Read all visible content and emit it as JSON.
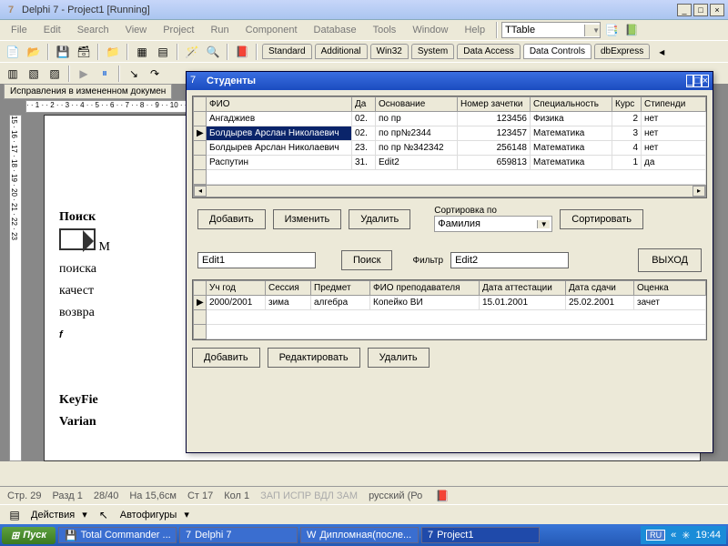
{
  "main_title": "Delphi 7 - Project1 [Running]",
  "menu": [
    "File",
    "Edit",
    "Search",
    "View",
    "Project",
    "Run",
    "Component",
    "Database",
    "Tools",
    "Window",
    "Help"
  ],
  "combo_class": "TTable",
  "palette_tabs": [
    "Standard",
    "Additional",
    "Win32",
    "System",
    "Data Access",
    "Data Controls",
    "dbExpress"
  ],
  "palette_active": 5,
  "doc_tab": "Исправления в измененном докумен",
  "page": {
    "heading": "Поиск",
    "lines": [
      "поиска",
      "качест",
      "возвра"
    ],
    "italic_f": "f",
    "key": "KeyFie",
    "varian": "Varian"
  },
  "child": {
    "title": "Студенты",
    "cols": [
      "ФИО",
      "Да",
      "Основание",
      "Номер зачетки",
      "Специальность",
      "Курс",
      "Стипенди"
    ],
    "rows": [
      {
        "fio": "Ангаджиев",
        "d": "02.",
        "osn": "по пр",
        "num": "123456",
        "spec": "Физика",
        "kurs": "2",
        "stip": "нет"
      },
      {
        "fio": "Болдырев Арслан Николаевич",
        "d": "02.",
        "osn": "по пр№2344",
        "num": "123457",
        "spec": "Математика",
        "kurs": "3",
        "stip": "нет"
      },
      {
        "fio": "Болдырев Арслан Николаевич",
        "d": "23.",
        "osn": "по пр №342342",
        "num": "256148",
        "spec": "Математика",
        "kurs": "4",
        "stip": "нет"
      },
      {
        "fio": "Распутин",
        "d": "31.",
        "osn": "Edit2",
        "num": "659813",
        "spec": "Математика",
        "kurs": "1",
        "stip": "да"
      }
    ],
    "sel_row": 1,
    "btns1": {
      "add": "Добавить",
      "edit": "Изменить",
      "del": "Удалить"
    },
    "sort_label": "Сортировка по",
    "sort_value": "Фамилия",
    "sort_btn": "Сортировать",
    "exit_btn": "ВЫХОД",
    "edit1": "Edit1",
    "search_btn": "Поиск",
    "filter_lbl": "Фильтр",
    "edit2": "Edit2",
    "cols2": [
      "Уч год",
      "Сессия",
      "Предмет",
      "ФИО преподавателя",
      "Дата аттестации",
      "Дата сдачи",
      "Оценка"
    ],
    "row2": {
      "year": "2000/2001",
      "sess": "зима",
      "subj": "алгебра",
      "teach": "Копейко ВИ",
      "att": "15.01.2001",
      "sd": "25.02.2001",
      "gr": "зачет"
    },
    "btns2": {
      "add": "Добавить",
      "edit": "Редактировать",
      "del": "Удалить"
    }
  },
  "bottombar": {
    "actions": "Действия",
    "autoshapes": "Автофигуры"
  },
  "status": {
    "s1": "Стр. 29",
    "s2": "Разд 1",
    "s3": "28/40",
    "s4": "На 15,6см",
    "s5": "Ст 17",
    "s6": "Кол 1",
    "dim": "ЗАП  ИСПР  ВДЛ  ЗАМ",
    "lang": "русский (Ро"
  },
  "taskbar": {
    "start": "Пуск",
    "items": [
      "Total Commander ...",
      "Delphi 7",
      "Дипломная(после...",
      "Project1"
    ],
    "active": 3,
    "lang": "RU",
    "time": "19:44"
  }
}
